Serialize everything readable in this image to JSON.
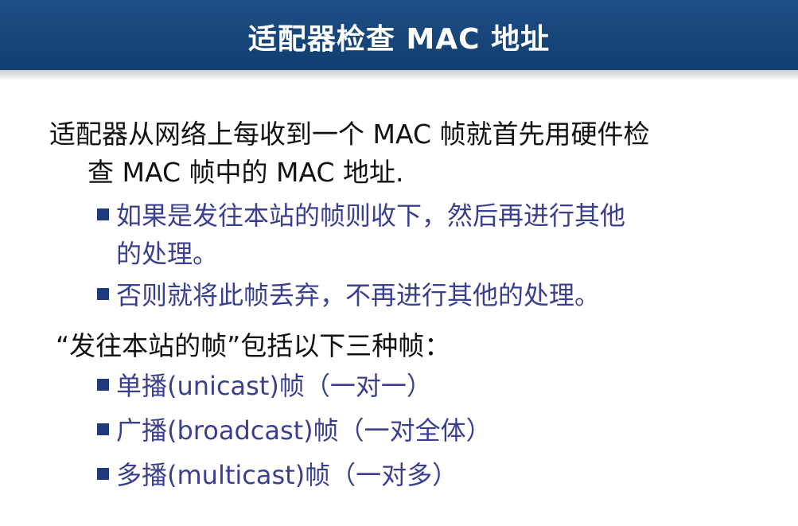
{
  "slide": {
    "title": "适配器检查 MAC 地址",
    "paragraph1": {
      "line1": "适配器从网络上每收到一个 MAC 帧就首先用硬件检",
      "line2": "查 MAC 帧中的 MAC 地址."
    },
    "sub1": {
      "line1": "如果是发往本站的帧则收下，然后再进行其他",
      "line2": "的处理。"
    },
    "sub2": "否则就将此帧丢弃，不再进行其他的处理。",
    "paragraph2": "“发往本站的帧”包括以下三种帧：",
    "frames": [
      "单播(unicast)帧（一对一）",
      "广播(broadcast)帧（一对全体）",
      "多播(multicast)帧（一对多）"
    ]
  },
  "colors": {
    "title_bar": "#1b4a80",
    "body_text": "#111111",
    "sub_text": "#3a3f8f",
    "bullet": "#1f3a7a"
  }
}
